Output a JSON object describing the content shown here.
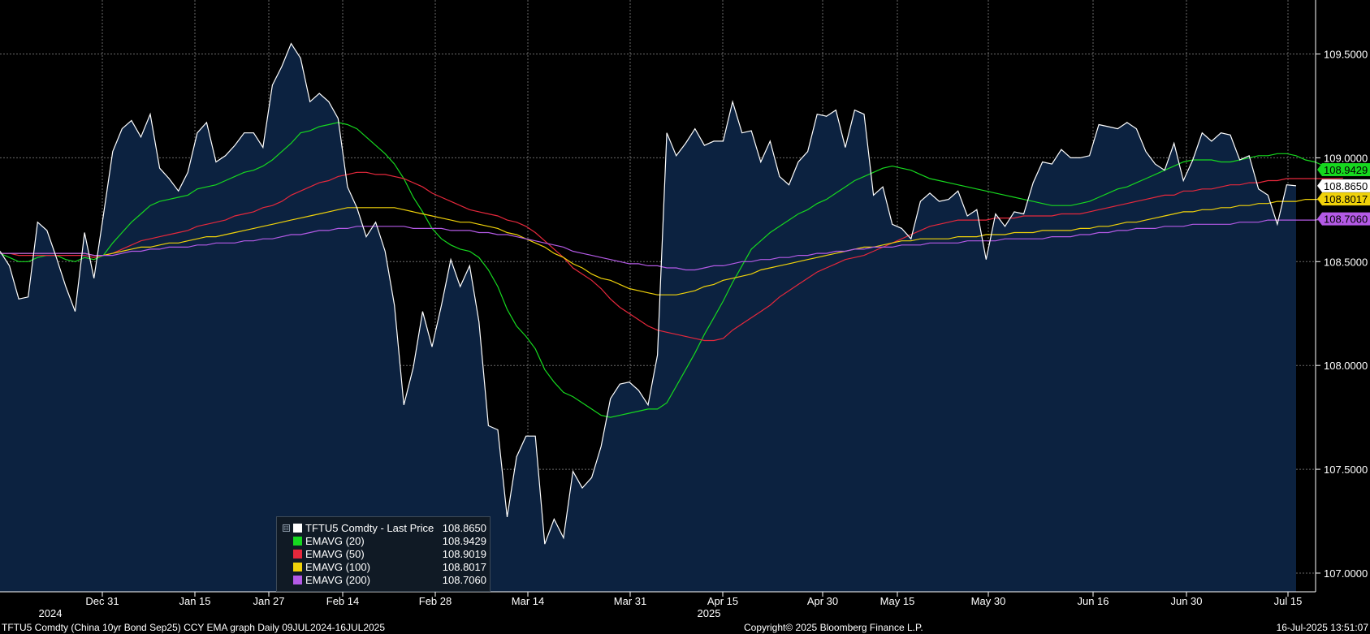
{
  "chart_data": {
    "type": "line",
    "y_ticks": [
      "109.5000",
      "109.0000",
      "108.5000",
      "108.0000",
      "107.5000",
      "107.0000"
    ],
    "ylim": [
      106.91,
      109.76
    ],
    "x_tick_labels": [
      "Dec 31",
      "Jan 15",
      "Jan 27",
      "Feb 14",
      "Feb 28",
      "Mar 14",
      "Mar 31",
      "Apr 15",
      "Apr 30",
      "May 15",
      "May 30",
      "Jun 16",
      "Jun 30",
      "Jul 15"
    ],
    "year_labels": [
      "2024",
      "2025"
    ],
    "grid": true,
    "series": [
      {
        "key": "price",
        "color": "#ffffff",
        "fill": "#0c2240",
        "values": [
          108.55,
          108.48,
          108.32,
          108.33,
          108.69,
          108.65,
          108.52,
          108.38,
          108.26,
          108.64,
          108.42,
          108.72,
          109.03,
          109.14,
          109.18,
          109.1,
          109.21,
          108.95,
          108.9,
          108.84,
          108.93,
          109.12,
          109.17,
          108.98,
          109.01,
          109.06,
          109.12,
          109.12,
          109.05,
          109.35,
          109.44,
          109.55,
          109.48,
          109.27,
          109.31,
          109.27,
          109.19,
          108.86,
          108.76,
          108.62,
          108.69,
          108.55,
          108.29,
          107.81,
          107.99,
          108.26,
          108.09,
          108.29,
          108.51,
          108.38,
          108.48,
          108.21,
          107.71,
          107.69,
          107.27,
          107.56,
          107.66,
          107.66,
          107.14,
          107.26,
          107.17,
          107.49,
          107.41,
          107.46,
          107.61,
          107.84,
          107.91,
          107.92,
          107.88,
          107.81,
          108.05,
          109.12,
          109.01,
          109.07,
          109.14,
          109.06,
          109.08,
          109.08,
          109.27,
          109.12,
          109.13,
          108.98,
          109.08,
          108.91,
          108.87,
          108.98,
          109.03,
          109.21,
          109.2,
          109.23,
          109.05,
          109.23,
          109.21,
          108.82,
          108.86,
          108.68,
          108.66,
          108.61,
          108.79,
          108.83,
          108.79,
          108.8,
          108.84,
          108.72,
          108.75,
          108.51,
          108.73,
          108.67,
          108.74,
          108.73,
          108.88,
          108.98,
          108.97,
          109.04,
          109.0,
          109.0,
          109.01,
          109.16,
          109.15,
          109.14,
          109.17,
          109.14,
          109.03,
          108.97,
          108.94,
          109.07,
          108.89,
          108.99,
          109.12,
          109.08,
          109.12,
          109.11,
          108.99,
          109.01,
          108.85,
          108.82,
          108.68,
          108.87,
          108.865
        ]
      },
      {
        "key": "ema20",
        "color": "#16d81f",
        "values": [
          108.54,
          108.52,
          108.5,
          108.5,
          108.52,
          108.53,
          108.53,
          108.51,
          108.5,
          108.52,
          108.51,
          108.53,
          108.59,
          108.64,
          108.69,
          108.73,
          108.77,
          108.79,
          108.8,
          108.81,
          108.82,
          108.85,
          108.86,
          108.87,
          108.89,
          108.91,
          108.93,
          108.94,
          108.96,
          108.99,
          109.03,
          109.07,
          109.12,
          109.13,
          109.15,
          109.16,
          109.17,
          109.16,
          109.14,
          109.1,
          109.06,
          109.02,
          108.97,
          108.9,
          108.81,
          108.74,
          108.66,
          108.61,
          108.58,
          108.56,
          108.55,
          108.52,
          108.46,
          108.38,
          108.27,
          108.19,
          108.14,
          108.08,
          107.98,
          107.92,
          107.87,
          107.85,
          107.82,
          107.79,
          107.76,
          107.75,
          107.76,
          107.77,
          107.78,
          107.79,
          107.79,
          107.82,
          107.9,
          107.98,
          108.06,
          108.15,
          108.23,
          108.31,
          108.4,
          108.48,
          108.56,
          108.6,
          108.64,
          108.67,
          108.7,
          108.73,
          108.75,
          108.78,
          108.8,
          108.83,
          108.86,
          108.89,
          108.91,
          108.93,
          108.95,
          108.96,
          108.95,
          108.94,
          108.92,
          108.9,
          108.89,
          108.88,
          108.87,
          108.86,
          108.85,
          108.84,
          108.83,
          108.82,
          108.81,
          108.8,
          108.79,
          108.78,
          108.77,
          108.77,
          108.77,
          108.78,
          108.79,
          108.81,
          108.83,
          108.85,
          108.86,
          108.88,
          108.9,
          108.92,
          108.94,
          108.96,
          108.98,
          108.99,
          108.99,
          108.99,
          108.98,
          108.98,
          108.99,
          109.0,
          109.01,
          109.01,
          109.02,
          109.02,
          109.01,
          108.99,
          108.98,
          108.96,
          108.95,
          108.943
        ]
      },
      {
        "key": "ema50",
        "color": "#e6283c",
        "values": [
          108.54,
          108.54,
          108.53,
          108.53,
          108.53,
          108.53,
          108.53,
          108.53,
          108.53,
          108.53,
          108.52,
          108.53,
          108.54,
          108.56,
          108.58,
          108.6,
          108.61,
          108.62,
          108.63,
          108.64,
          108.65,
          108.67,
          108.68,
          108.69,
          108.7,
          108.72,
          108.73,
          108.74,
          108.76,
          108.77,
          108.79,
          108.82,
          108.84,
          108.86,
          108.88,
          108.89,
          108.91,
          108.92,
          108.93,
          108.93,
          108.92,
          108.92,
          108.91,
          108.9,
          108.88,
          108.86,
          108.83,
          108.81,
          108.79,
          108.77,
          108.75,
          108.74,
          108.73,
          108.72,
          108.7,
          108.69,
          108.67,
          108.64,
          108.6,
          108.56,
          108.52,
          108.47,
          108.44,
          108.41,
          108.37,
          108.32,
          108.28,
          108.25,
          108.22,
          108.19,
          108.17,
          108.16,
          108.15,
          108.14,
          108.13,
          108.12,
          108.12,
          108.13,
          108.17,
          108.2,
          108.23,
          108.26,
          108.29,
          108.33,
          108.36,
          108.39,
          108.42,
          108.45,
          108.47,
          108.49,
          108.51,
          108.52,
          108.53,
          108.55,
          108.57,
          108.59,
          108.61,
          108.63,
          108.65,
          108.67,
          108.68,
          108.69,
          108.7,
          108.7,
          108.7,
          108.7,
          108.71,
          108.71,
          108.71,
          108.72,
          108.72,
          108.72,
          108.72,
          108.73,
          108.73,
          108.73,
          108.74,
          108.75,
          108.76,
          108.77,
          108.78,
          108.79,
          108.8,
          108.81,
          108.82,
          108.82,
          108.84,
          108.84,
          108.85,
          108.85,
          108.86,
          108.87,
          108.87,
          108.88,
          108.88,
          108.89,
          108.89,
          108.9,
          108.9,
          108.9,
          108.9,
          108.9,
          108.9,
          108.902
        ]
      },
      {
        "key": "ema100",
        "color": "#f0d20a",
        "values": [
          108.54,
          108.54,
          108.54,
          108.54,
          108.54,
          108.54,
          108.54,
          108.54,
          108.54,
          108.54,
          108.53,
          108.53,
          108.54,
          108.55,
          108.56,
          108.57,
          108.57,
          108.58,
          108.59,
          108.59,
          108.6,
          108.61,
          108.62,
          108.62,
          108.63,
          108.64,
          108.65,
          108.66,
          108.67,
          108.68,
          108.69,
          108.7,
          108.71,
          108.72,
          108.73,
          108.74,
          108.75,
          108.76,
          108.76,
          108.76,
          108.76,
          108.76,
          108.76,
          108.75,
          108.74,
          108.73,
          108.72,
          108.71,
          108.7,
          108.69,
          108.69,
          108.68,
          108.67,
          108.66,
          108.64,
          108.63,
          108.61,
          108.59,
          108.57,
          108.54,
          108.52,
          108.49,
          108.47,
          108.44,
          108.42,
          108.41,
          108.39,
          108.37,
          108.36,
          108.35,
          108.34,
          108.34,
          108.34,
          108.35,
          108.36,
          108.38,
          108.39,
          108.41,
          108.42,
          108.43,
          108.44,
          108.46,
          108.47,
          108.48,
          108.49,
          108.5,
          108.51,
          108.52,
          108.53,
          108.54,
          108.55,
          108.56,
          108.57,
          108.57,
          108.58,
          108.59,
          108.6,
          108.6,
          108.61,
          108.61,
          108.61,
          108.61,
          108.62,
          108.62,
          108.62,
          108.63,
          108.63,
          108.63,
          108.64,
          108.64,
          108.64,
          108.65,
          108.65,
          108.65,
          108.65,
          108.66,
          108.66,
          108.67,
          108.67,
          108.68,
          108.69,
          108.69,
          108.7,
          108.71,
          108.72,
          108.73,
          108.74,
          108.74,
          108.75,
          108.75,
          108.76,
          108.76,
          108.77,
          108.77,
          108.78,
          108.78,
          108.79,
          108.79,
          108.79,
          108.8,
          108.8,
          108.8,
          108.8,
          108.8,
          108.802
        ]
      },
      {
        "key": "ema200",
        "color": "#b45ae6",
        "values": [
          108.54,
          108.54,
          108.54,
          108.54,
          108.54,
          108.54,
          108.54,
          108.54,
          108.54,
          108.54,
          108.53,
          108.53,
          108.53,
          108.54,
          108.55,
          108.55,
          108.56,
          108.56,
          108.57,
          108.57,
          108.57,
          108.58,
          108.58,
          108.59,
          108.59,
          108.59,
          108.6,
          108.6,
          108.61,
          108.61,
          108.62,
          108.63,
          108.63,
          108.64,
          108.65,
          108.65,
          108.66,
          108.66,
          108.67,
          108.67,
          108.67,
          108.67,
          108.67,
          108.67,
          108.66,
          108.66,
          108.66,
          108.66,
          108.65,
          108.65,
          108.65,
          108.64,
          108.64,
          108.63,
          108.63,
          108.62,
          108.61,
          108.6,
          108.59,
          108.58,
          108.57,
          108.55,
          108.54,
          108.53,
          108.52,
          108.51,
          108.5,
          108.49,
          108.49,
          108.48,
          108.48,
          108.47,
          108.47,
          108.46,
          108.46,
          108.47,
          108.48,
          108.48,
          108.49,
          108.5,
          108.5,
          108.51,
          108.51,
          108.52,
          108.52,
          108.53,
          108.53,
          108.54,
          108.54,
          108.55,
          108.55,
          108.56,
          108.56,
          108.57,
          108.57,
          108.57,
          108.58,
          108.58,
          108.58,
          108.59,
          108.59,
          108.59,
          108.59,
          108.6,
          108.6,
          108.6,
          108.6,
          108.61,
          108.61,
          108.61,
          108.61,
          108.61,
          108.62,
          108.62,
          108.62,
          108.63,
          108.63,
          108.64,
          108.64,
          108.65,
          108.65,
          108.66,
          108.66,
          108.66,
          108.67,
          108.67,
          108.67,
          108.68,
          108.68,
          108.68,
          108.68,
          108.68,
          108.69,
          108.69,
          108.69,
          108.7,
          108.7,
          108.7,
          108.7,
          108.7,
          108.7,
          108.706
        ]
      }
    ],
    "last_value_tags": [
      {
        "text": "108.9429",
        "bg": "#16d81f",
        "fg": "#000000",
        "y": 108.9429
      },
      {
        "text": "108.8650",
        "bg": "#ffffff",
        "fg": "#000000",
        "y": 108.865
      },
      {
        "text": "108.8017",
        "bg": "#f0d20a",
        "fg": "#000000",
        "y": 108.8017
      },
      {
        "text": "108.7060",
        "bg": "#b45ae6",
        "fg": "#000000",
        "y": 108.706
      }
    ]
  },
  "legend": {
    "collapse": "⊟",
    "rows": [
      {
        "name": "TFTU5 Comdty - Last Price",
        "value": "108.8650",
        "color": "#ffffff"
      },
      {
        "name": "EMAVG (20)",
        "value": "108.9429",
        "color": "#16d81f"
      },
      {
        "name": "EMAVG (50)",
        "value": "108.9019",
        "color": "#e6283c"
      },
      {
        "name": "EMAVG (100)",
        "value": "108.8017",
        "color": "#f0d20a"
      },
      {
        "name": "EMAVG (200)",
        "value": "108.7060",
        "color": "#b45ae6"
      }
    ]
  },
  "footer": {
    "left": "TFTU5 Comdty (China 10yr Bond   Sep25) CCY EMA graph  Daily 09JUL2024-16JUL2025",
    "center": "Copyright© 2025 Bloomberg Finance L.P.",
    "right": "16-Jul-2025 13:51:07"
  }
}
